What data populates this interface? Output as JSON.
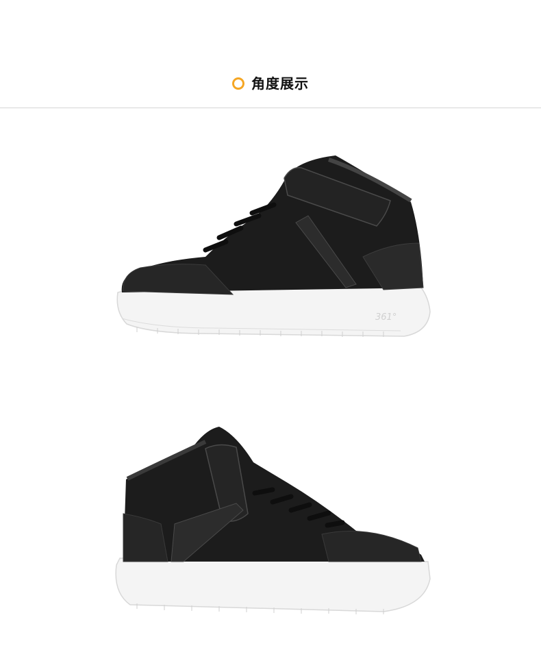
{
  "section": {
    "title": "角度展示",
    "accent_color": "#f5a623",
    "ring_icon": "circle-ring-icon"
  },
  "images": [
    {
      "name": "shoe-side-view",
      "description_icon": "sneaker-side"
    },
    {
      "name": "shoe-rear-angle-view",
      "description_icon": "sneaker-angle"
    }
  ],
  "sole_logo": "361°"
}
